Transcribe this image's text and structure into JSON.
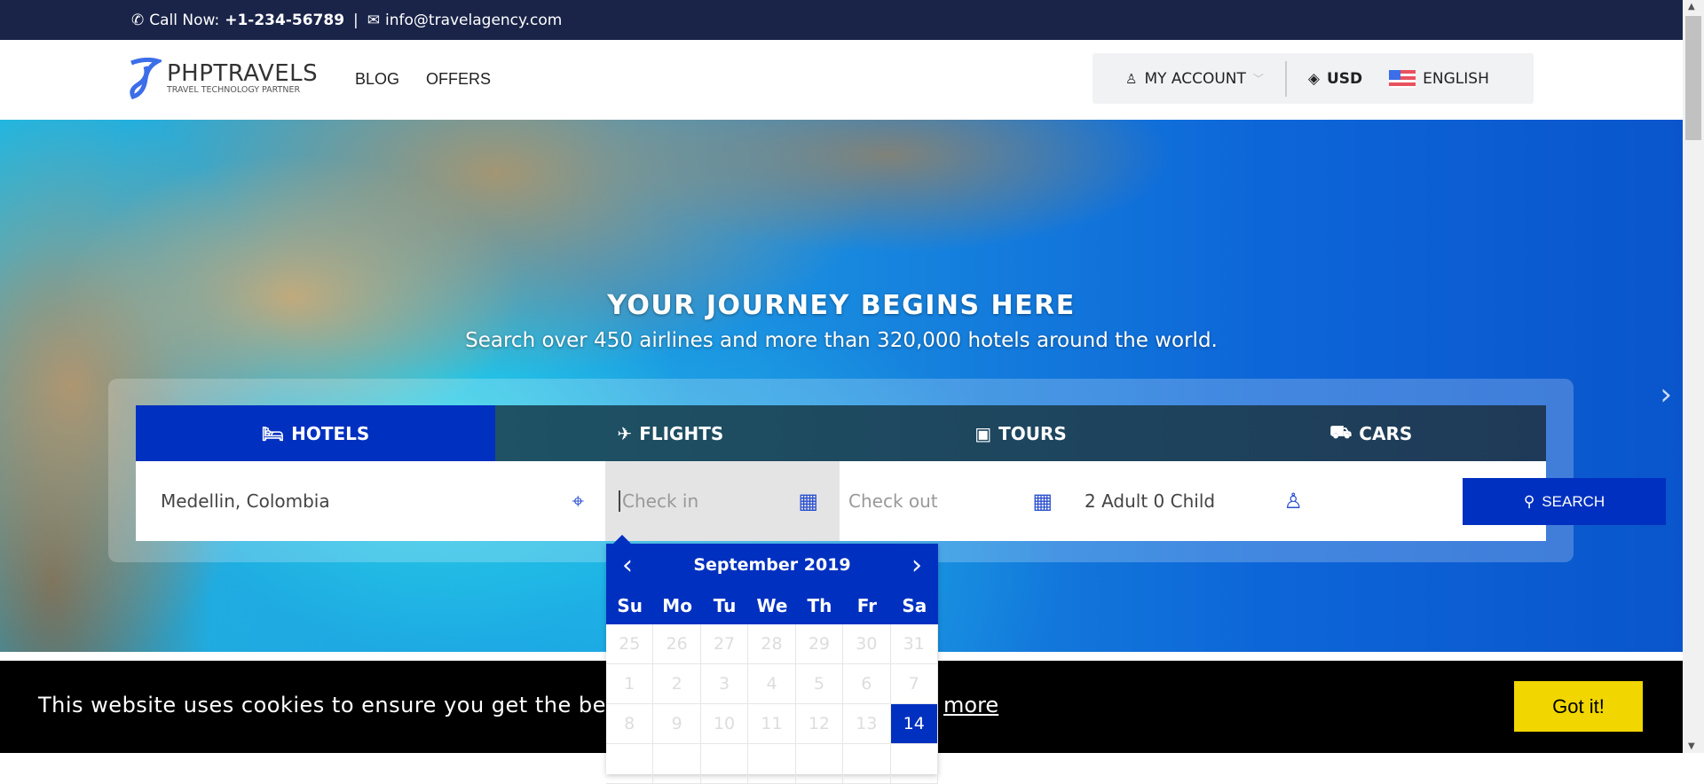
{
  "topbar": {
    "call_label": "Call Now:",
    "phone": "+1-234-56789",
    "separator": "|",
    "email": "info@travelagency.com"
  },
  "header": {
    "logo_title": "PHPTRAVELS",
    "logo_subtitle": "TRAVEL TECHNOLOGY PARTNER",
    "nav": [
      "BLOG",
      "OFFERS"
    ],
    "account": "MY ACCOUNT",
    "currency": "USD",
    "language": "ENGLISH"
  },
  "hero": {
    "title": "YOUR JOURNEY BEGINS HERE",
    "subtitle": "Search over 450 airlines and more than 320,000 hotels around the world."
  },
  "tabs": [
    {
      "label": "HOTELS",
      "icon": "bed-icon",
      "active": true
    },
    {
      "label": "FLIGHTS",
      "icon": "plane-icon"
    },
    {
      "label": "TOURS",
      "icon": "suitcase-icon"
    },
    {
      "label": "CARS",
      "icon": "car-icon"
    }
  ],
  "search": {
    "location": "Medellin, Colombia",
    "checkin_placeholder": "Check in",
    "checkout_placeholder": "Check out",
    "guests": "2 Adult 0 Child",
    "button": "SEARCH"
  },
  "calendar": {
    "month": "September 2019",
    "weekdays": [
      "Su",
      "Mo",
      "Tu",
      "We",
      "Th",
      "Fr",
      "Sa"
    ],
    "rows": [
      [
        "25",
        "26",
        "27",
        "28",
        "29",
        "30",
        "31"
      ],
      [
        "1",
        "2",
        "3",
        "4",
        "5",
        "6",
        "7"
      ],
      [
        "8",
        "9",
        "10",
        "11",
        "12",
        "13",
        "14"
      ]
    ],
    "selected": "14"
  },
  "cookie": {
    "text": "This website uses cookies to ensure you get the best ex",
    "link": "more",
    "button": "Got it!"
  },
  "colors": {
    "primary": "#0030c0",
    "topbar": "#1a2449",
    "cookie_button": "#f1d600"
  }
}
